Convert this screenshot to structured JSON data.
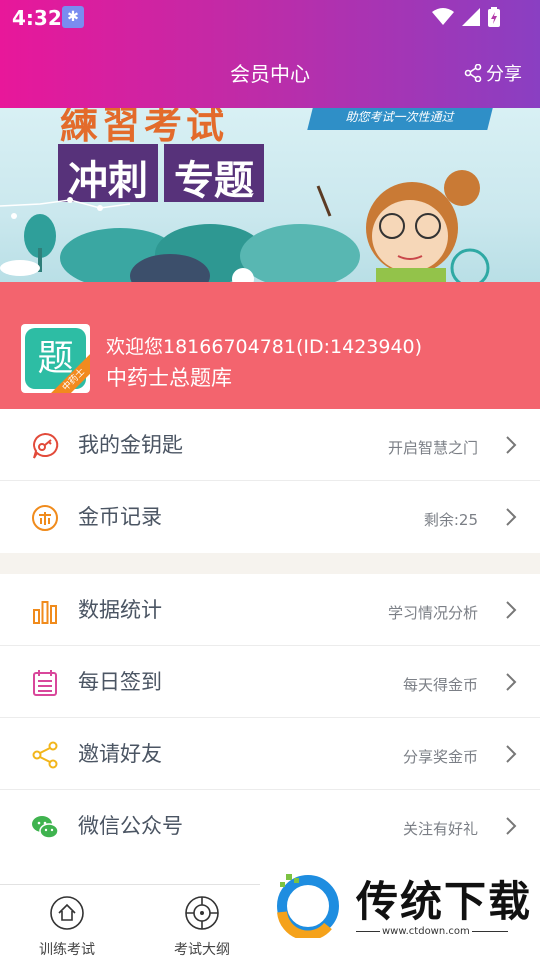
{
  "status_bar": {
    "time": "4:32"
  },
  "header": {
    "title": "会员中心",
    "share_label": "分享"
  },
  "banner": {
    "tag_line": "助您考试一次性通过",
    "top_text": "練習考试",
    "title_part1": "冲刺",
    "title_part2": "专题"
  },
  "profile": {
    "welcome": "欢迎您18166704781(ID:1423940)",
    "bank_name": "中药士总题库",
    "avatar_char": "题",
    "avatar_tag": "中药士"
  },
  "menu": [
    {
      "label": "我的金钥匙",
      "hint": "开启智慧之门",
      "icon": "key-icon"
    },
    {
      "label": "金币记录",
      "hint": "剩余:25",
      "icon": "coin-icon"
    },
    {
      "label": "数据统计",
      "hint": "学习情况分析",
      "icon": "bar-chart-icon"
    },
    {
      "label": "每日签到",
      "hint": "每天得金币",
      "icon": "calendar-icon"
    },
    {
      "label": "邀请好友",
      "hint": "分享奖金币",
      "icon": "share-icon"
    },
    {
      "label": "微信公众号",
      "hint": "关注有好礼",
      "icon": "wechat-icon"
    }
  ],
  "tabs": [
    {
      "label": "训练考试",
      "icon": "home-icon"
    },
    {
      "label": "考试大纲",
      "icon": "target-icon"
    }
  ],
  "watermark": {
    "text": "传统下载",
    "url": "www.ctdown.com"
  },
  "colors": {
    "header_start": "#e8179a",
    "header_end": "#8a3fc2",
    "profile_bg": "#f3646e"
  }
}
